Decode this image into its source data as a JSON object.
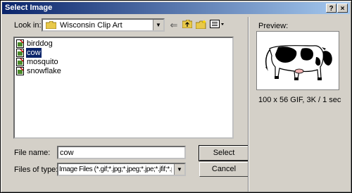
{
  "window": {
    "title": "Select Image",
    "help_glyph": "?",
    "close_glyph": "×"
  },
  "lookin": {
    "label": "Look in:",
    "value": "Wisconsin Clip Art"
  },
  "files": [
    {
      "name": "birddog",
      "selected": false
    },
    {
      "name": "cow",
      "selected": true
    },
    {
      "name": "mosquito",
      "selected": false
    },
    {
      "name": "snowflake",
      "selected": false
    }
  ],
  "filename": {
    "label": "File name:",
    "value": "cow"
  },
  "filetype": {
    "label": "Files of type:",
    "value": "Image Files (*.gif;*.jpg;*.jpeg;*.jpe;*.jfif;*.png)"
  },
  "buttons": {
    "select": "Select",
    "cancel": "Cancel"
  },
  "preview": {
    "label": "Preview:",
    "info": "100 x 56 GIF, 3K / 1 sec"
  },
  "colors": {
    "titlebar_start": "#0a246a",
    "titlebar_end": "#a6caf0",
    "face": "#d4d0c8",
    "selection": "#0a246a"
  }
}
